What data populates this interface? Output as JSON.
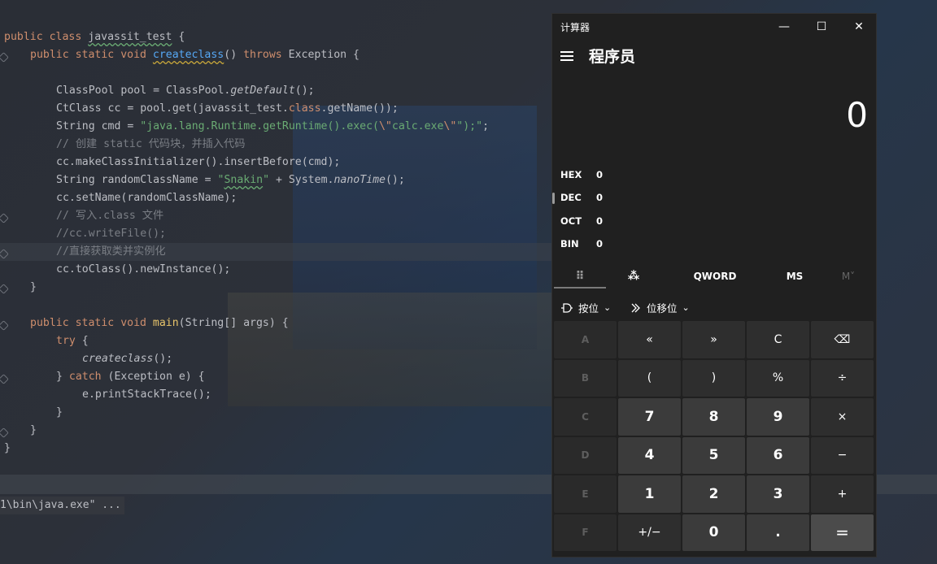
{
  "editor": {
    "lines": {
      "l1": {
        "kw1": "public",
        "kw2": "class",
        "cls": "javassit_test",
        "rest": " {"
      },
      "l2": {
        "kw1": "public",
        "kw2": "static",
        "kw3": "void",
        "fn": "createclass",
        "mid": "() ",
        "kw4": "throws",
        "rest": " Exception {"
      },
      "l4": {
        "a": "ClassPool pool = ClassPool.",
        "b": "getDefault",
        "c": "();"
      },
      "l5": {
        "a": "CtClass cc = pool.get(javassit_test.",
        "kw": "class",
        "b": ".getName());"
      },
      "l6": {
        "a": "String cmd = ",
        "s1": "\"java.lang.Runtime.getRuntime().exec(",
        "esc1": "\\\"",
        "s2": "calc.exe",
        "esc2": "\\\"",
        "s3": "\");\"",
        "c": ";"
      },
      "l7": "// 创建 static 代码块，并插入代码",
      "l8": "cc.makeClassInitializer().insertBefore(cmd);",
      "l9": {
        "a": "String randomClassName = ",
        "s1": "\"",
        "s2": "Snakin",
        "s3": "\"",
        "b": " + System.",
        "c": "nanoTime",
        "d": "();"
      },
      "l10": "cc.setName(randomClassName);",
      "l11": "// 写入.class 文件",
      "l12": "//cc.writeFile();",
      "l13": "//直接获取类并实例化",
      "l14": "cc.toClass().newInstance();",
      "l15": "}",
      "l17": {
        "kw1": "public",
        "kw2": "static",
        "kw3": "void",
        "fn": "main",
        "rest": "(String[] args) {"
      },
      "l18": {
        "kw": "try",
        "rest": " {"
      },
      "l19": {
        "fn": "createclass",
        "rest": "();"
      },
      "l20": {
        "a": "} ",
        "kw": "catch",
        "b": " (Exception e) {"
      },
      "l21": "e.printStackTrace();",
      "l22": "}",
      "l23": "}",
      "l24": "}"
    },
    "run_output": "1\\bin\\java.exe\" ..."
  },
  "calculator": {
    "title": "计算器",
    "mode": "程序员",
    "display": "0",
    "window_buttons": {
      "minimize": "—",
      "maximize": "☐",
      "close": "✕"
    },
    "radix": [
      {
        "name": "HEX",
        "value": "0"
      },
      {
        "name": "DEC",
        "value": "0"
      },
      {
        "name": "OCT",
        "value": "0"
      },
      {
        "name": "BIN",
        "value": "0"
      }
    ],
    "tabs": {
      "keypad": "⠿",
      "bitflip": "⁂",
      "word": "QWORD",
      "ms": "MS",
      "mplus": "M˅"
    },
    "bitops": {
      "bitwise": "按位",
      "shift": "位移位",
      "chevron": "⌄"
    },
    "keys": [
      [
        "A",
        "«",
        "»",
        "C",
        "⌫"
      ],
      [
        "B",
        "(",
        ")",
        "%",
        "÷"
      ],
      [
        "C",
        "7",
        "8",
        "9",
        "×"
      ],
      [
        "D",
        "4",
        "5",
        "6",
        "−"
      ],
      [
        "E",
        "1",
        "2",
        "3",
        "+"
      ],
      [
        "F",
        "+/−",
        "0",
        ".",
        "="
      ]
    ]
  }
}
